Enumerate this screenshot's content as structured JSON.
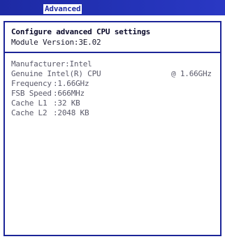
{
  "top_bar": {
    "active_tab": "Advanced",
    "colors": {
      "bar": "#1d2aa4",
      "tab_bg": "#ffffff",
      "panel_border": "#1c2598"
    }
  },
  "panel": {
    "title": "Configure advanced CPU settings",
    "module_version": "Module Version:3E.02",
    "manufacturer": "Manufacturer:Intel",
    "cpu_name": "Genuine Intel(R) CPU",
    "cpu_speed_tag": "@ 1.66GHz",
    "fields": {
      "frequency": {
        "label": "Frequency",
        "value": ":1.66GHz"
      },
      "fsb_speed": {
        "label": "FSB Speed",
        "value": ":666MHz"
      },
      "cache_l1": {
        "label": "Cache L1",
        "value": ":32 KB"
      },
      "cache_l2": {
        "label": "Cache L2",
        "value": ":2048 KB"
      }
    }
  }
}
